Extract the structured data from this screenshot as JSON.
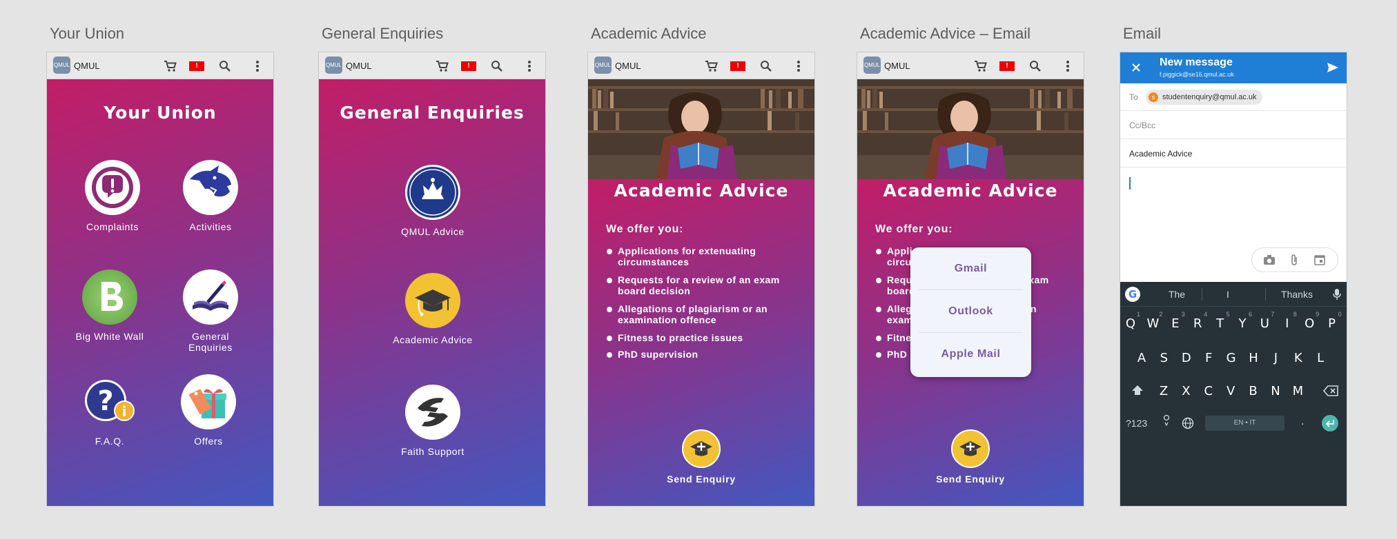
{
  "screens": {
    "s1_caption": "Your Union",
    "s2_caption": "General Enquiries",
    "s3_caption": "Academic Advice",
    "s4_caption": "Academic Advice – Email",
    "s5_caption": "Email"
  },
  "appbar": {
    "app_name": "QMUL",
    "logo_text": "QMUL",
    "badge_text": "!"
  },
  "colors": {
    "gradient_top": "#c21d66",
    "gradient_mid": "#8c3289",
    "gradient_bottom": "#4258bf",
    "mail_blue": "#1f7fd6",
    "keyboard_bg": "#263238",
    "accent_purple": "#7c5aa8"
  },
  "your_union": {
    "title": "Your Union",
    "tiles": [
      {
        "label": "Complaints",
        "icon": "complaint-speech-icon"
      },
      {
        "label": "Activities",
        "icon": "panther-icon"
      },
      {
        "label": "Big White Wall",
        "icon": "big-white-wall-logo"
      },
      {
        "label": "General Enquiries",
        "icon": "book-pen-icon"
      },
      {
        "label": "F.A.Q.",
        "icon": "question-info-icon"
      },
      {
        "label": "Offers",
        "icon": "gift-tag-icon"
      }
    ]
  },
  "general_enquiries": {
    "title": "General Enquiries",
    "tiles": [
      {
        "label": "QMUL Advice",
        "icon": "qmul-crest-icon"
      },
      {
        "label": "Academic Advice",
        "icon": "graduation-cap-icon"
      },
      {
        "label": "Faith Support",
        "icon": "hands-icon"
      }
    ]
  },
  "academic_advice": {
    "title": "Academic Advice",
    "offer_heading": "We offer you:",
    "items": [
      "Applications for extenuating circumstances",
      "Requests for a review of an exam board decision",
      "Allegations of plagiarism or an examination offence",
      "Fitness to practice issues",
      "PhD supervision"
    ],
    "send_label": "Send Enquiry"
  },
  "email_popup": {
    "options": [
      "Gmail",
      "Outlook",
      "Apple Mail"
    ]
  },
  "email_compose": {
    "header_title": "New message",
    "from_address": "f.piggick@se16.qmul.ac.uk",
    "to_label": "To",
    "to_chip": "studentenquiry@qmul.ac.uk",
    "to_chip_initial": "s",
    "cc_label": "Cc/Bcc",
    "subject": "Academic Advice"
  },
  "keyboard": {
    "suggestions": [
      "The",
      "I",
      "Thanks"
    ],
    "row1": [
      "Q",
      "W",
      "E",
      "R",
      "T",
      "Y",
      "U",
      "I",
      "O",
      "P"
    ],
    "row1_hints": [
      "1",
      "2",
      "3",
      "4",
      "5",
      "6",
      "7",
      "8",
      "9",
      "0"
    ],
    "row2": [
      "A",
      "S",
      "D",
      "F",
      "G",
      "H",
      "J",
      "K",
      "L"
    ],
    "row3": [
      "Z",
      "X",
      "C",
      "V",
      "B",
      "N",
      "M"
    ],
    "symbols_key": "?123",
    "space_label": "EN • IT",
    "period_key": "."
  }
}
